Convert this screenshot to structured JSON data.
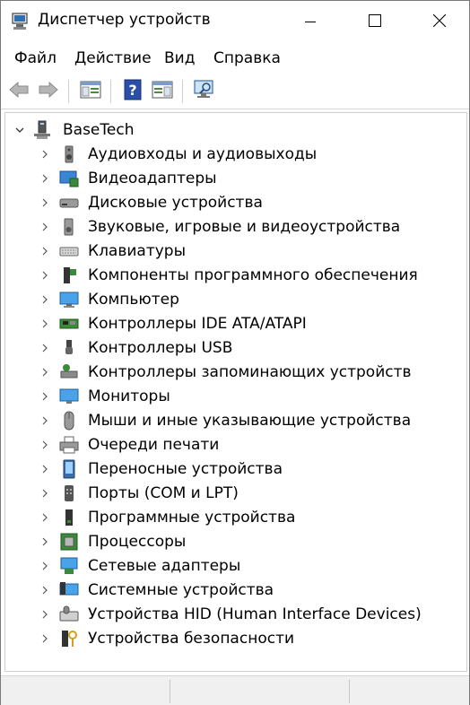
{
  "window": {
    "title": "Диспетчер устройств"
  },
  "menu": [
    "Файл",
    "Действие",
    "Вид",
    "Справка"
  ],
  "tree": {
    "root": "BaseTech",
    "items": [
      {
        "label": "Аудиовходы и аудиовыходы",
        "icon": "speaker-icon"
      },
      {
        "label": "Видеоадаптеры",
        "icon": "display-adapter-icon"
      },
      {
        "label": "Дисковые устройства",
        "icon": "disk-drive-icon"
      },
      {
        "label": "Звуковые, игровые и видеоустройства",
        "icon": "sound-icon"
      },
      {
        "label": "Клавиатуры",
        "icon": "keyboard-icon"
      },
      {
        "label": "Компоненты программного обеспечения",
        "icon": "software-component-icon"
      },
      {
        "label": "Компьютер",
        "icon": "computer-icon"
      },
      {
        "label": "Контроллеры IDE ATA/ATAPI",
        "icon": "ide-controller-icon"
      },
      {
        "label": "Контроллеры USB",
        "icon": "usb-icon"
      },
      {
        "label": "Контроллеры запоминающих устройств",
        "icon": "storage-controller-icon"
      },
      {
        "label": "Мониторы",
        "icon": "monitor-icon"
      },
      {
        "label": "Мыши и иные указывающие устройства",
        "icon": "mouse-icon"
      },
      {
        "label": "Очереди печати",
        "icon": "printer-icon"
      },
      {
        "label": "Переносные устройства",
        "icon": "portable-device-icon"
      },
      {
        "label": "Порты (COM и LPT)",
        "icon": "port-icon"
      },
      {
        "label": "Программные устройства",
        "icon": "software-device-icon"
      },
      {
        "label": "Процессоры",
        "icon": "processor-icon"
      },
      {
        "label": "Сетевые адаптеры",
        "icon": "network-adapter-icon"
      },
      {
        "label": "Системные устройства",
        "icon": "system-device-icon"
      },
      {
        "label": "Устройства HID (Human Interface Devices)",
        "icon": "hid-icon"
      },
      {
        "label": "Устройства безопасности",
        "icon": "security-device-icon"
      }
    ]
  }
}
